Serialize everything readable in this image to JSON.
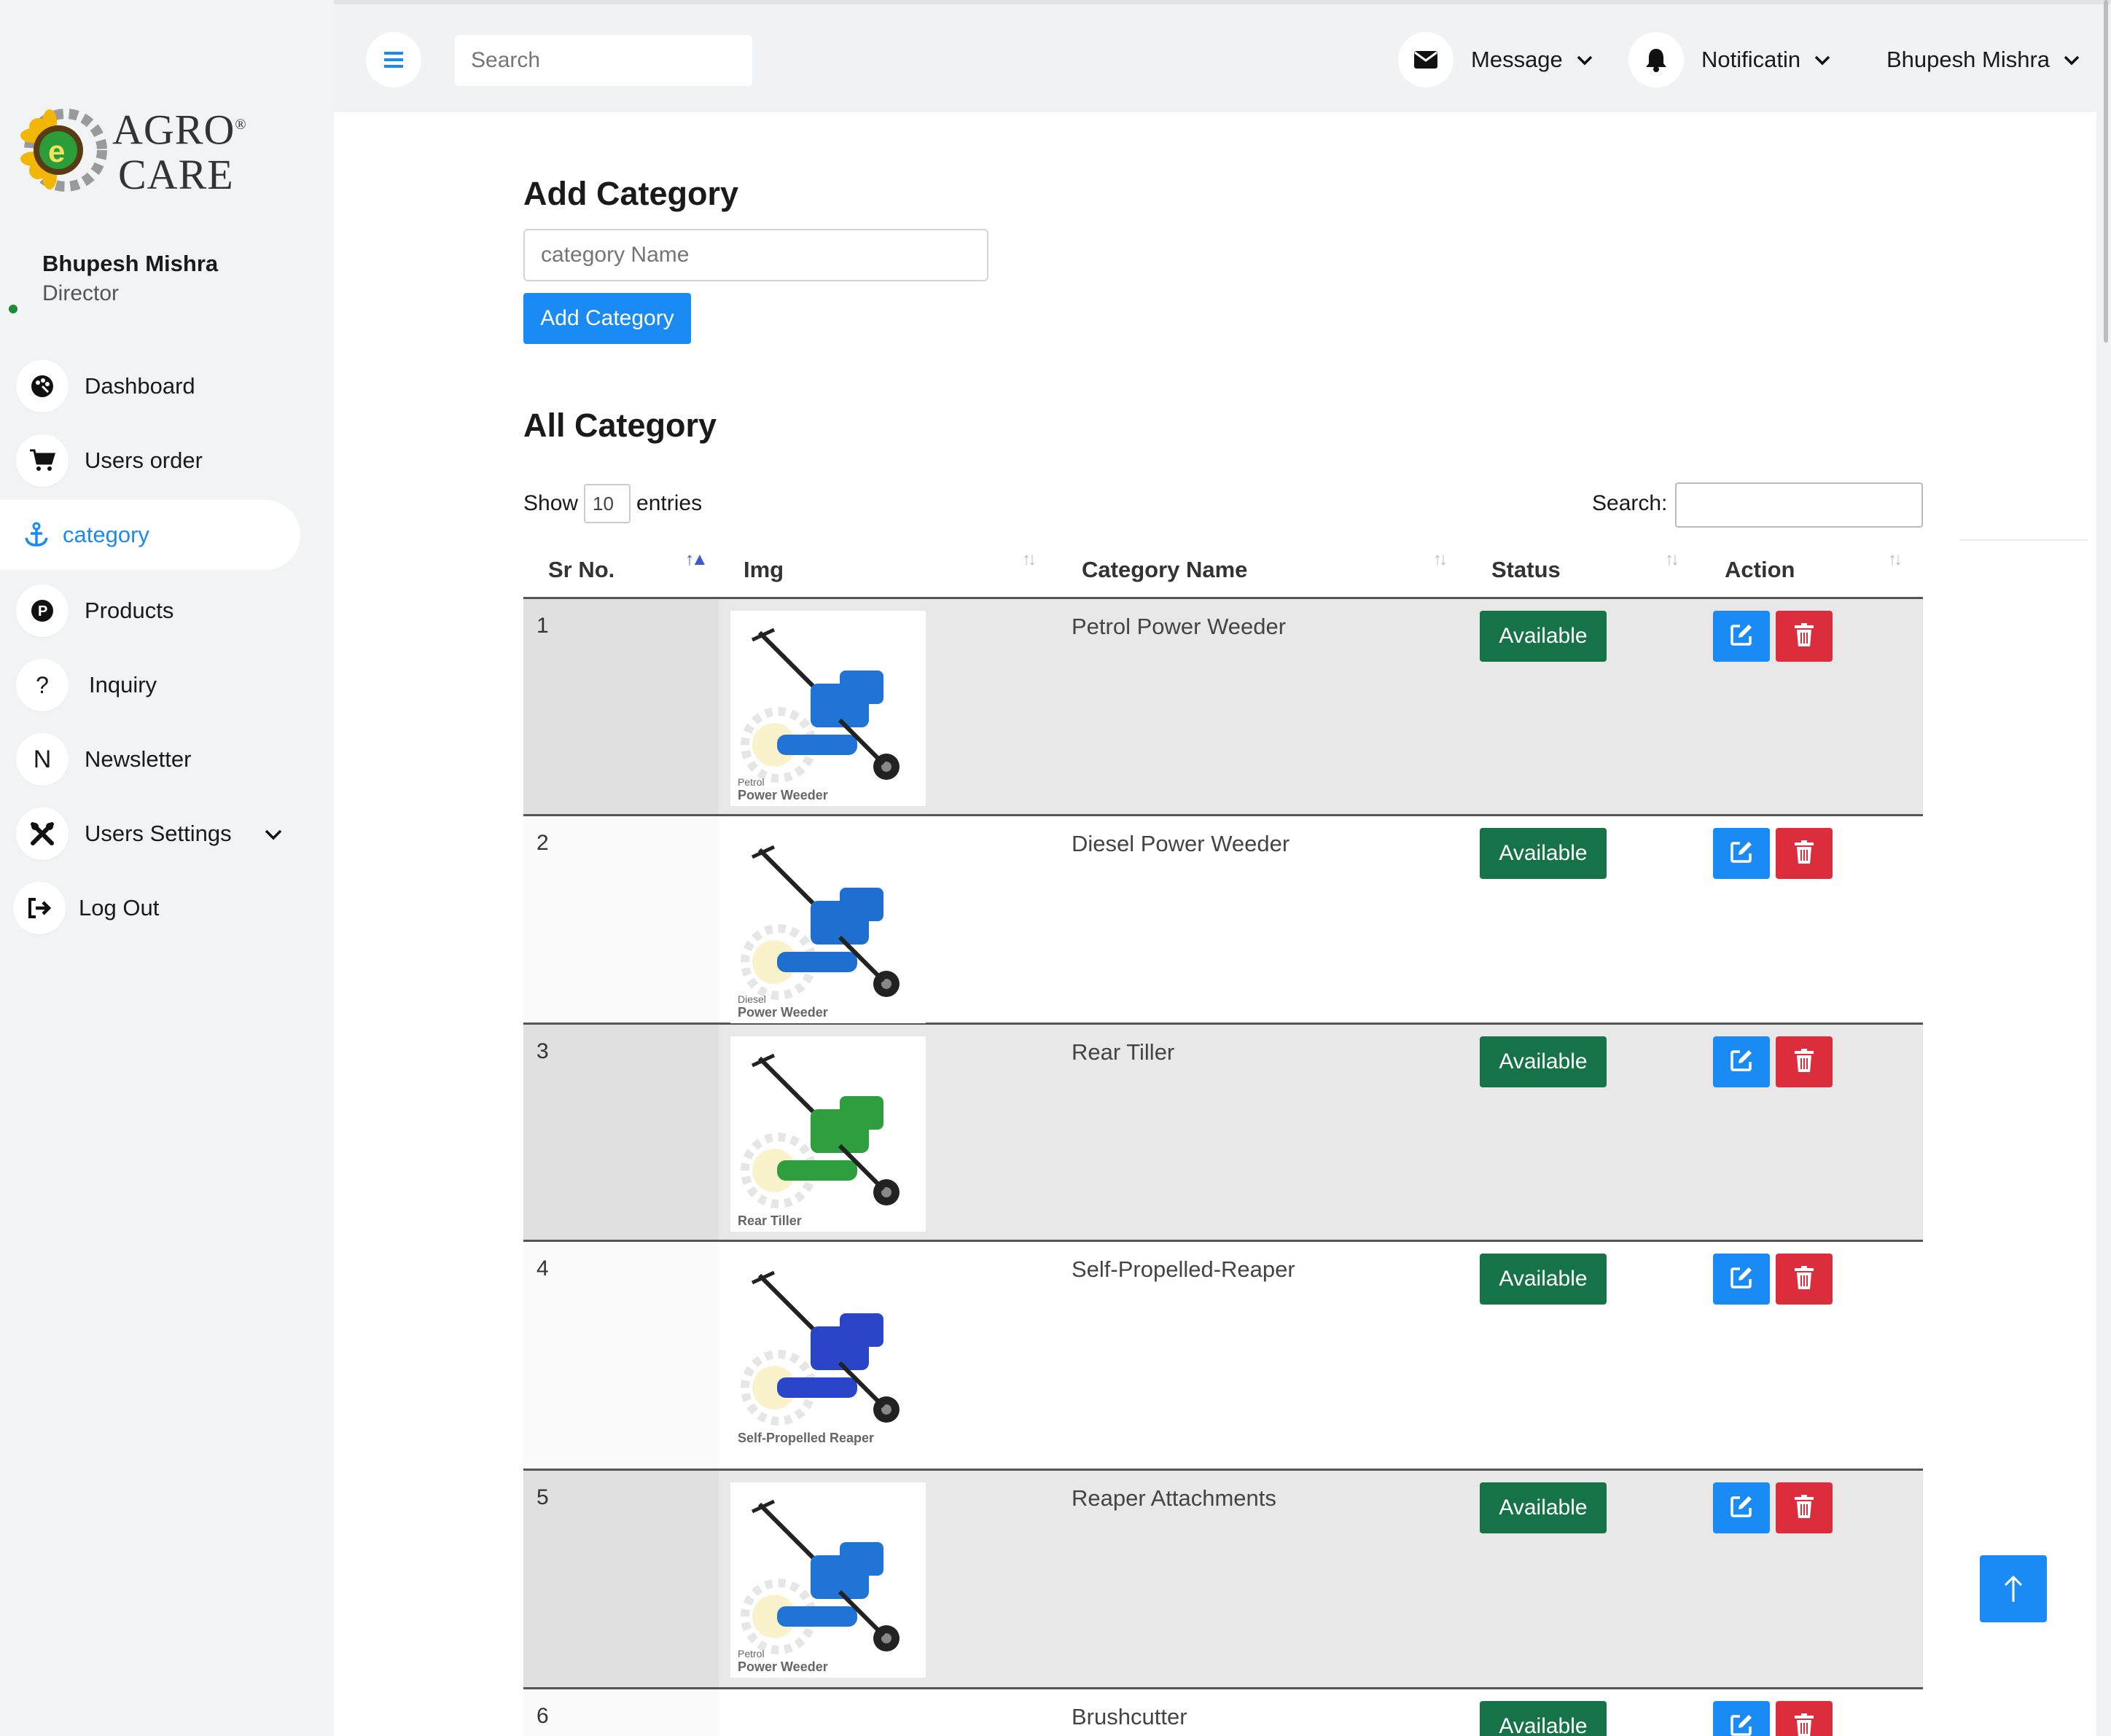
{
  "logo": {
    "line1": "AGRO",
    "line2": "CARE",
    "registered": "®"
  },
  "profile": {
    "name": "Bhupesh Mishra",
    "role": "Director"
  },
  "sidebar": {
    "items": [
      {
        "label": "Dashboard",
        "icon": "palette-icon",
        "glyph": "✇"
      },
      {
        "label": "Users order",
        "icon": "cart-icon",
        "glyph": "🛒"
      },
      {
        "label": "category",
        "icon": "anchor-icon",
        "glyph": "⚓",
        "active": true
      },
      {
        "label": "Products",
        "icon": "product-p-icon",
        "glyph": "P"
      },
      {
        "label": "Inquiry",
        "icon": "question-icon",
        "glyph": "?"
      },
      {
        "label": "Newsletter",
        "icon": "newsletter-n-icon",
        "glyph": "N"
      },
      {
        "label": "Users Settings",
        "icon": "tools-icon",
        "glyph": "✖"
      },
      {
        "label": "Log Out",
        "icon": "logout-icon",
        "glyph": "➲"
      }
    ]
  },
  "topbar": {
    "search_placeholder": "Search",
    "message_label": "Message",
    "notification_label": "Notificatin",
    "user_label": "Bhupesh Mishra"
  },
  "add_category": {
    "heading": "Add Category",
    "input_placeholder": "category Name",
    "button_label": "Add Category"
  },
  "all_category": {
    "heading": "All Category",
    "show_label": "Show",
    "entries_value": "10",
    "entries_label": "entries",
    "search_label": "Search:",
    "columns": [
      "Sr No.",
      "Img",
      "Category Name",
      "Status",
      "Action"
    ],
    "rows": [
      {
        "sr": "1",
        "name": "Petrol Power Weeder",
        "status": "Available",
        "caption_small": "Petrol",
        "caption": "Power Weeder",
        "machine_color": "#1f74d6"
      },
      {
        "sr": "2",
        "name": "Diesel Power Weeder",
        "status": "Available",
        "caption_small": "Diesel",
        "caption": "Power Weeder",
        "machine_color": "#1f6fd0"
      },
      {
        "sr": "3",
        "name": "Rear Tiller",
        "status": "Available",
        "caption_small": "",
        "caption": "Rear Tiller",
        "machine_color": "#2e9e3e"
      },
      {
        "sr": "4",
        "name": "Self-Propelled-Reaper",
        "status": "Available",
        "caption_small": "",
        "caption": "Self-Propelled Reaper",
        "machine_color": "#2a45c8"
      },
      {
        "sr": "5",
        "name": "Reaper Attachments",
        "status": "Available",
        "caption_small": "Petrol",
        "caption": "Power Weeder",
        "machine_color": "#1f74d6"
      },
      {
        "sr": "6",
        "name": "Brushcutter",
        "status": "Available",
        "caption_small": "",
        "caption": "",
        "machine_color": "#1f74d6"
      }
    ]
  },
  "colors": {
    "accent": "#1a8bf5",
    "available": "#157347",
    "delete": "#dc2d3c"
  }
}
